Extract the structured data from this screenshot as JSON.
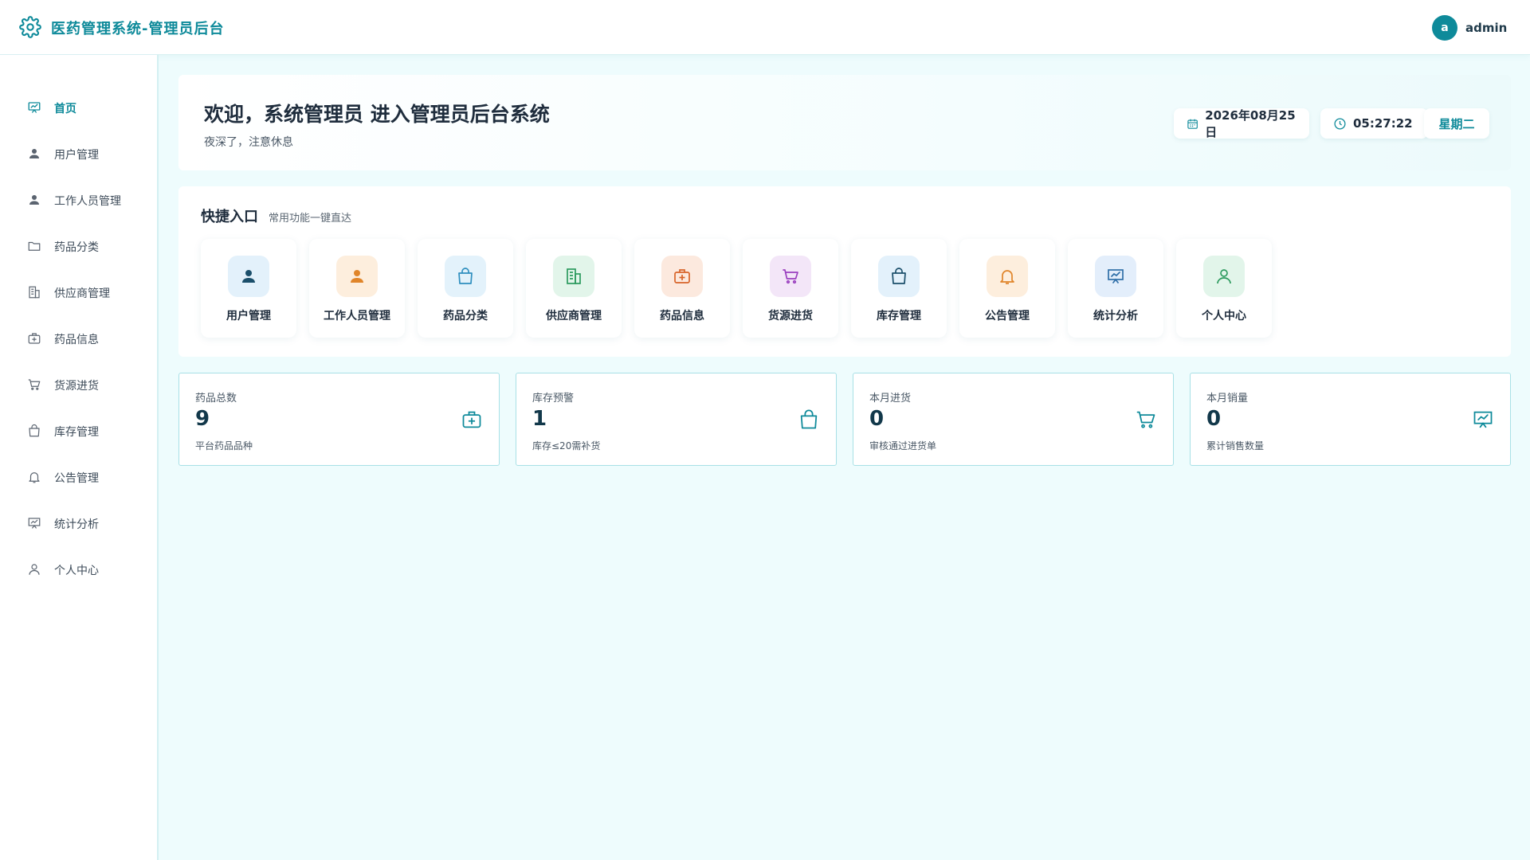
{
  "header": {
    "title": "医药管理系统-管理员后台",
    "avatar_letter": "a",
    "username": "admin",
    "brand_color": "#0e8a9a"
  },
  "sidebar": {
    "items": [
      {
        "label": "首页",
        "icon": "dashboard-icon",
        "active": true
      },
      {
        "label": "用户管理",
        "icon": "user-icon"
      },
      {
        "label": "工作人员管理",
        "icon": "user-icon"
      },
      {
        "label": "药品分类",
        "icon": "folder-icon"
      },
      {
        "label": "供应商管理",
        "icon": "building-icon"
      },
      {
        "label": "药品信息",
        "icon": "medkit-icon"
      },
      {
        "label": "货源进货",
        "icon": "cart-icon"
      },
      {
        "label": "库存管理",
        "icon": "bag-icon"
      },
      {
        "label": "公告管理",
        "icon": "bell-icon"
      },
      {
        "label": "统计分析",
        "icon": "chart-board-icon"
      },
      {
        "label": "个人中心",
        "icon": "person-outline-icon"
      }
    ]
  },
  "welcome": {
    "title": "欢迎，系统管理员 进入管理员后台系统",
    "subtitle": "夜深了，注意休息",
    "date": "2026年08月25日",
    "time": "05:27:22",
    "weekday": "星期二"
  },
  "quick": {
    "title": "快捷入口",
    "subtitle": "常用功能一键直达",
    "items": [
      {
        "label": "用户管理",
        "icon": "user-icon",
        "color": "#1b4f6b",
        "bg": "#e3f1fb"
      },
      {
        "label": "工作人员管理",
        "icon": "user-icon",
        "color": "#e0852a",
        "bg": "#fdeedd"
      },
      {
        "label": "药品分类",
        "icon": "bag-icon",
        "color": "#2f8fbf",
        "bg": "#e3f2fb"
      },
      {
        "label": "供应商管理",
        "icon": "building-icon",
        "color": "#2c9a5e",
        "bg": "#e2f5ea"
      },
      {
        "label": "药品信息",
        "icon": "medkit-icon",
        "color": "#d8642a",
        "bg": "#fce9de"
      },
      {
        "label": "货源进货",
        "icon": "cart-icon",
        "color": "#9a3fbf",
        "bg": "#f3e6f8"
      },
      {
        "label": "库存管理",
        "icon": "bag-icon",
        "color": "#1b4f6b",
        "bg": "#e3f1fb"
      },
      {
        "label": "公告管理",
        "icon": "bell-icon",
        "color": "#e0852a",
        "bg": "#fdeedd"
      },
      {
        "label": "统计分析",
        "icon": "chart-board-icon",
        "color": "#2f6fa8",
        "bg": "#e3eefb"
      },
      {
        "label": "个人中心",
        "icon": "person-outline-icon",
        "color": "#2c9a5e",
        "bg": "#e2f5ea"
      }
    ]
  },
  "stats": [
    {
      "label": "药品总数",
      "value": "9",
      "note": "平台药品品种",
      "icon": "medkit-icon"
    },
    {
      "label": "库存预警",
      "value": "1",
      "note": "库存≤20需补货",
      "icon": "bag-icon"
    },
    {
      "label": "本月进货",
      "value": "0",
      "note": "审核通过进货单",
      "icon": "cart-icon"
    },
    {
      "label": "本月销量",
      "value": "0",
      "note": "累计销售数量",
      "icon": "chart-board-icon"
    }
  ]
}
